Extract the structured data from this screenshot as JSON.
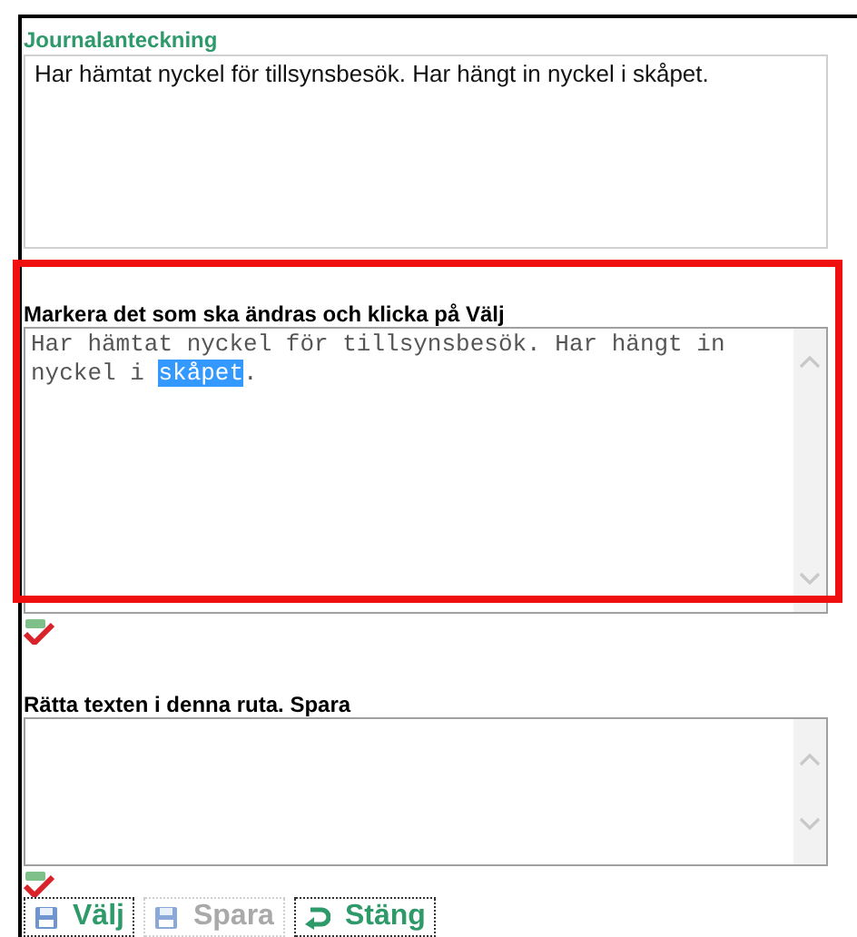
{
  "journal": {
    "label": "Journalanteckning",
    "text": "Har hämtat nyckel för tillsynsbesök. Har hängt in nyckel i skåpet."
  },
  "select_section": {
    "label": "Markera det som ska ändras och klicka på Välj",
    "text_before": "Har hämtat nyckel för tillsynsbesök. Har hängt in nyckel i ",
    "selected_text": "skåpet",
    "text_after": "."
  },
  "correct_section": {
    "label": "Rätta texten i denna ruta. Spara"
  },
  "highlight_frame": {
    "visible": true
  },
  "buttons": [
    {
      "label": "Välj",
      "kind": "save",
      "disabled": false
    },
    {
      "label": "Spara",
      "kind": "save",
      "disabled": true
    },
    {
      "label": "Stäng",
      "kind": "close",
      "disabled": false
    }
  ]
}
